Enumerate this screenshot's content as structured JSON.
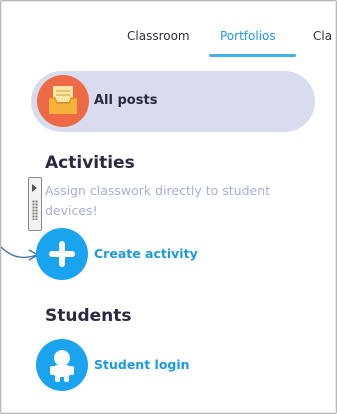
{
  "tabs": [
    {
      "label": "Classroom",
      "active": false
    },
    {
      "label": "Portfolios",
      "active": true
    },
    {
      "label": "Cla",
      "active": false
    }
  ],
  "all_posts": {
    "label": "All posts",
    "icon": "tray-icon",
    "icon_color": "#EE6A47"
  },
  "activities": {
    "title": "Activities",
    "description": "Assign classwork directly to student devices!",
    "create_button": {
      "label": "Create activity",
      "icon": "plus-icon"
    }
  },
  "students": {
    "title": "Students",
    "login_button": {
      "label": "Student login",
      "icon": "student-icon"
    }
  },
  "colors": {
    "accent": "#1B9AE4",
    "button_circle": "#1AA3EE",
    "pill_bg": "#D9DBEF",
    "description_text": "#A9AED9",
    "heading_text": "#2A2A45"
  }
}
